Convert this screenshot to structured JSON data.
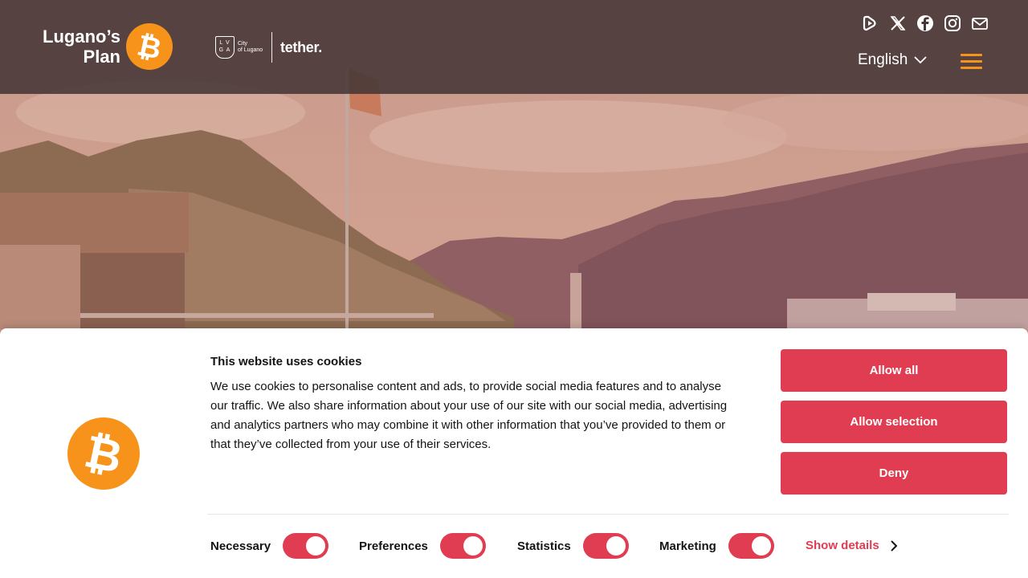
{
  "header": {
    "logo_text_line1": "Lugano’s",
    "logo_text_line2": "Plan",
    "partner_lvga": "L V G A",
    "partner_city_line1": "City",
    "partner_city_line2": "of Lugano",
    "partner_tether": "tether.",
    "language": "English",
    "social_icons": [
      "rumble-icon",
      "x-icon",
      "facebook-icon",
      "instagram-icon",
      "mail-icon"
    ]
  },
  "cookie_banner": {
    "title": "This website uses cookies",
    "text": "We use cookies to personalise content and ads, to provide social media features and to analyse our traffic. We also share information about your use of our site with our social media, advertising and analytics partners who may combine it with other information that you’ve provided to them or that they’ve collected from your use of their services.",
    "allow_all": "Allow all",
    "allow_selection": "Allow selection",
    "deny": "Deny",
    "toggles": [
      {
        "label": "Necessary",
        "on": true
      },
      {
        "label": "Preferences",
        "on": true
      },
      {
        "label": "Statistics",
        "on": true
      },
      {
        "label": "Marketing",
        "on": true
      }
    ],
    "show_details": "Show details"
  },
  "colors": {
    "bitcoin_orange": "#f7931a",
    "accent_red": "#e13d52",
    "header_bg": "#463737"
  }
}
